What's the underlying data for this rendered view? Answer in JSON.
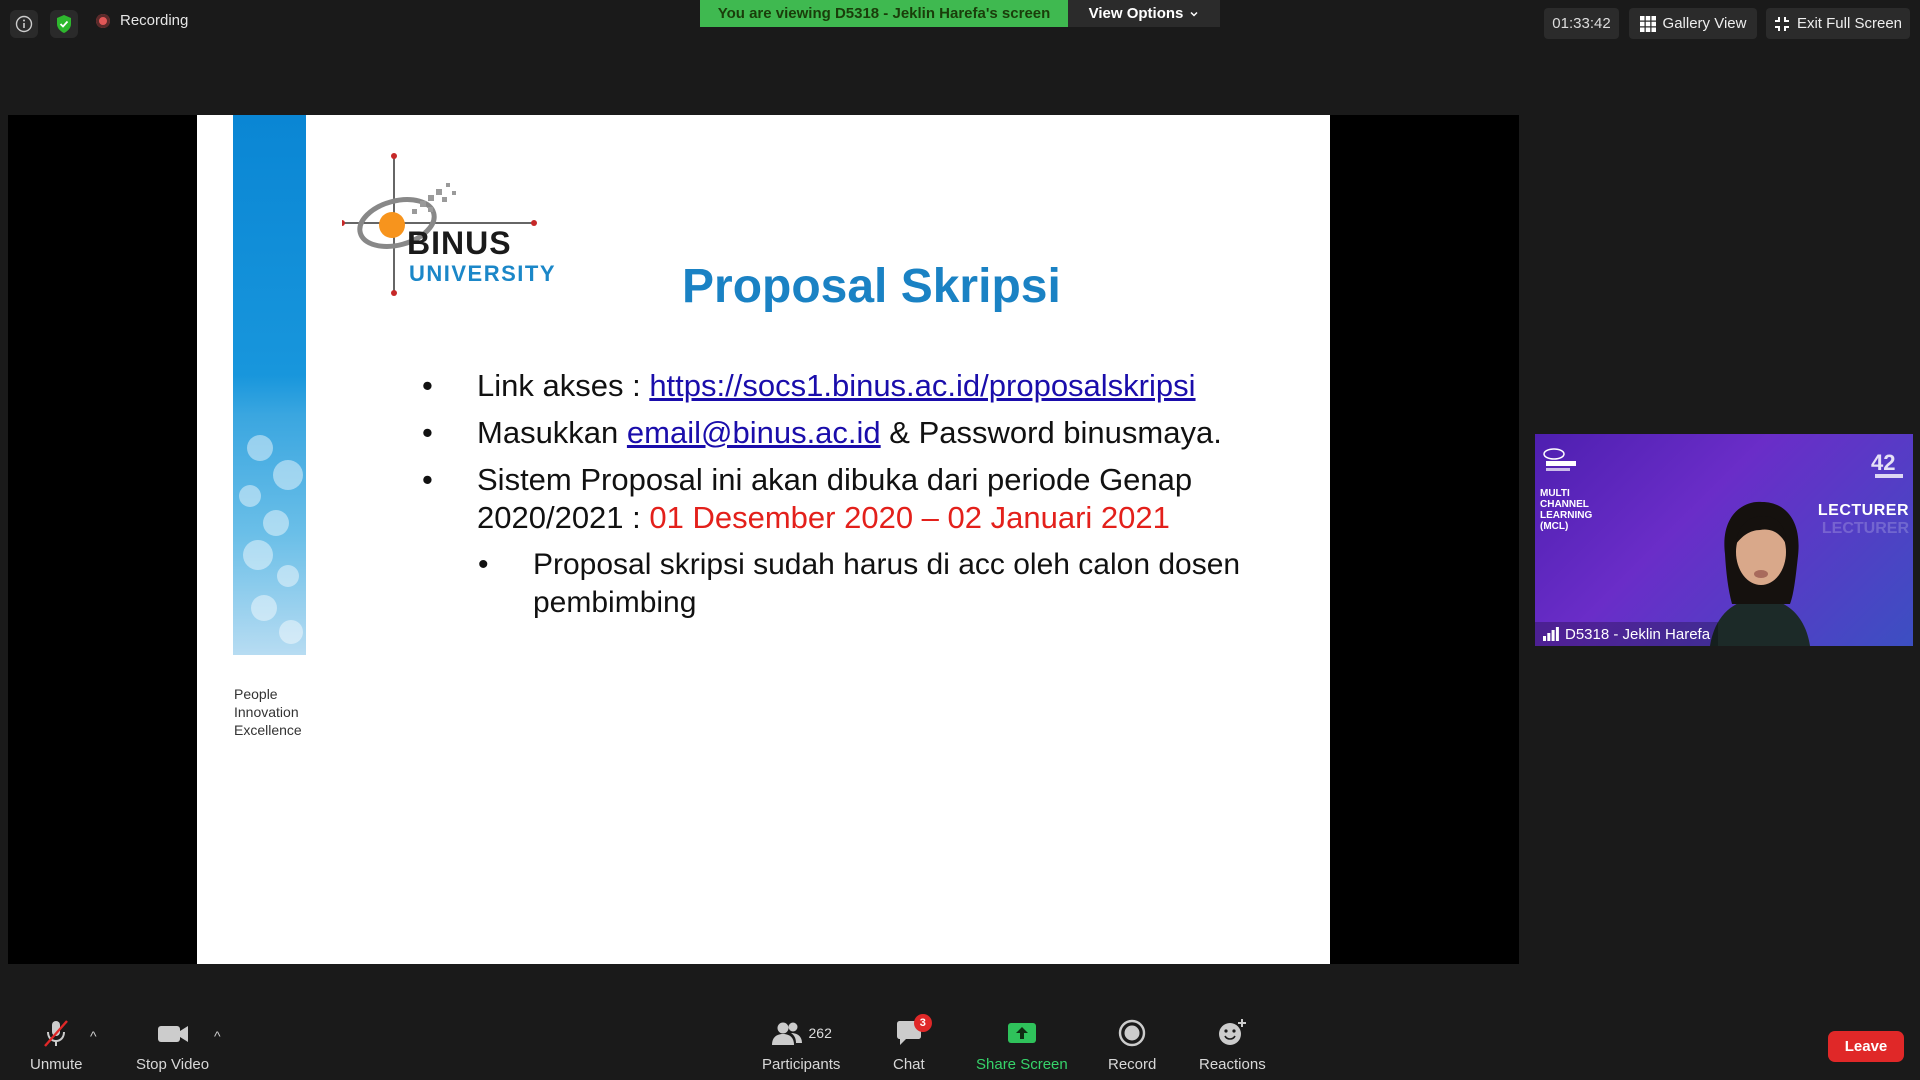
{
  "topbar": {
    "recording_label": "Recording",
    "viewing_banner": "You are viewing D5318 - Jeklin Harefa's screen",
    "view_options": "View Options",
    "timer": "01:33:42",
    "gallery_view": "Gallery View",
    "exit_full_screen": "Exit Full Screen"
  },
  "slide": {
    "logo_line1": "BINUS",
    "logo_line2": "UNIVERSITY",
    "tagline": [
      "People",
      "Innovation",
      "Excellence"
    ],
    "title": "Proposal Skripsi",
    "bullet1_prefix": "Link akses : ",
    "bullet1_link": "https://socs1.binus.ac.id/proposalskripsi",
    "bullet2_prefix": "Masukkan ",
    "bullet2_link": "email@binus.ac.id",
    "bullet2_suffix": " & Password binusmaya.",
    "bullet3_text": "Sistem Proposal ini akan dibuka dari periode Genap 2020/2021 :",
    "bullet3_dates": "01 Desember 2020 – 02 Januari 2021",
    "sub_bullet": "Proposal skripsi sudah harus di acc oleh calon dosen pembimbing",
    "colors": {
      "title": "#1a82c4",
      "dates": "#e3201b",
      "link": "#1a0dab"
    }
  },
  "participant_tile": {
    "mcl_label": [
      "MULTI",
      "CHANNEL",
      "LEARNING",
      "(MCL)"
    ],
    "lecturer_label": "LECTURER",
    "name": "D5318 - Jeklin Harefa"
  },
  "toolbar": {
    "unmute": "Unmute",
    "stop_video": "Stop Video",
    "participants": "Participants",
    "participants_count": "262",
    "chat": "Chat",
    "chat_badge": "3",
    "share_screen": "Share Screen",
    "record": "Record",
    "reactions": "Reactions",
    "leave": "Leave"
  }
}
